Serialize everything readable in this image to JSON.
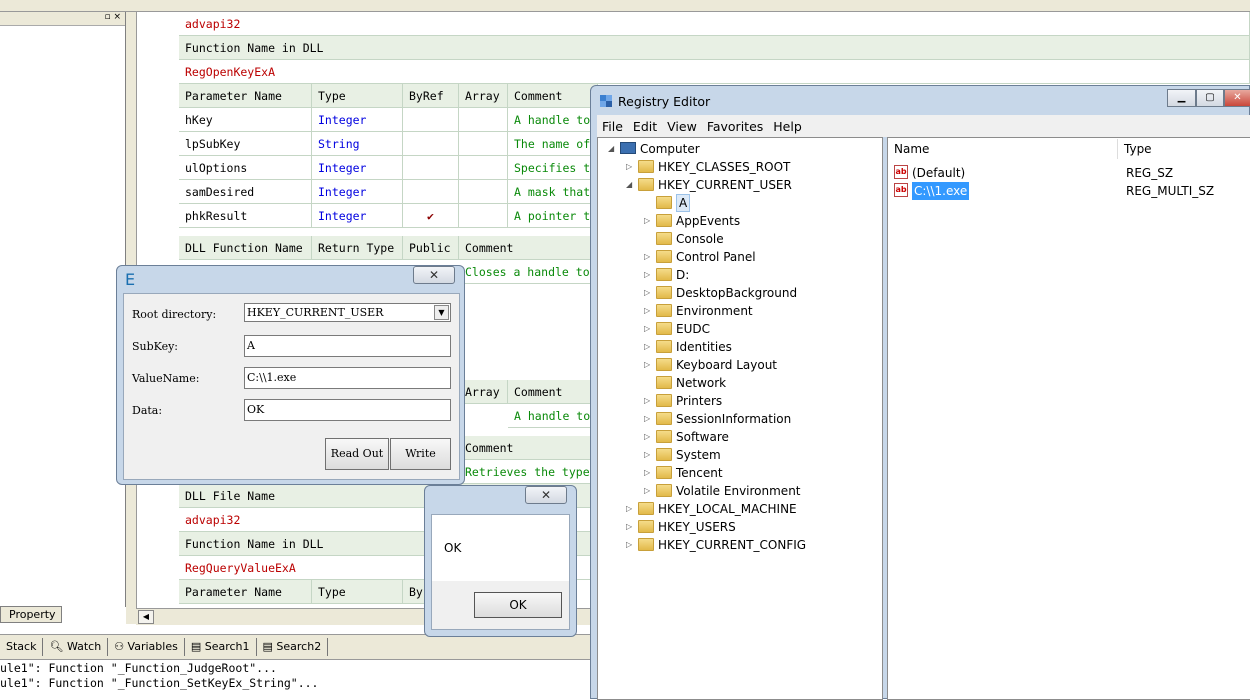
{
  "ide": {
    "left_pane_btns": "▫ ×",
    "property_tab": "Property",
    "bottom_tabs": [
      "Stack",
      "Watch",
      "Variables",
      "Search1",
      "Search2"
    ],
    "output_lines": [
      "ule1\": Function \"_Function_JudgeRoot\"...",
      "ule1\": Function \"_Function_SetKeyEx_String\"..."
    ],
    "code": {
      "dll1": "advapi32",
      "fn_in_dll_label": "Function Name in DLL",
      "fn1": "RegOpenKeyExA",
      "param_headers": [
        "Parameter Name",
        "Type",
        "ByRef",
        "Array",
        "Comment"
      ],
      "params": [
        {
          "name": "hKey",
          "type": "Integer",
          "byref": "",
          "comment": "A handle to"
        },
        {
          "name": "lpSubKey",
          "type": "String",
          "byref": "",
          "comment": "The name of"
        },
        {
          "name": "ulOptions",
          "type": "Integer",
          "byref": "",
          "comment": "Specifies t"
        },
        {
          "name": "samDesired",
          "type": "Integer",
          "byref": "",
          "comment": "A mask that"
        },
        {
          "name": "phkResult",
          "type": "Integer",
          "byref": "✔",
          "comment": "A pointer t"
        }
      ],
      "dll_fn_headers": [
        "DLL Function Name",
        "Return Type",
        "Public",
        "Comment"
      ],
      "row_closes": "Closes a handle to",
      "array_label": "Array",
      "comment_label": "Comment",
      "row_a_handle": "A handle to",
      "comment_label2": "Comment",
      "row_retrieves": "Retrieves the type",
      "dll_file_label": "DLL File Name",
      "dll2": "advapi32",
      "fn_in_dll_label2": "Function Name in DLL",
      "fn2": "RegQueryValueExA",
      "param_name_label": "Parameter Name",
      "type_label": "Type",
      "byref_partial": "By"
    }
  },
  "e_dialog": {
    "title": "E",
    "close": "✕",
    "root_label": "Root directory:",
    "root_value": "HKEY_CURRENT_USER",
    "subkey_label": "SubKey:",
    "subkey_value": "A",
    "valuename_label": "ValueName:",
    "valuename_value": "C:\\\\1.exe",
    "data_label": "Data:",
    "data_value": "OK",
    "readout_btn": "Read Out",
    "write_btn": "Write"
  },
  "ok_dialog": {
    "close": "✕",
    "message": "OK",
    "ok_btn": "OK"
  },
  "registry": {
    "title": "Registry Editor",
    "menu": [
      "File",
      "Edit",
      "View",
      "Favorites",
      "Help"
    ],
    "tree": {
      "computer": "Computer",
      "roots": [
        "HKEY_CLASSES_ROOT",
        "HKEY_CURRENT_USER",
        "HKEY_LOCAL_MACHINE",
        "HKEY_USERS",
        "HKEY_CURRENT_CONFIG"
      ],
      "hkcu_children": [
        "A",
        "AppEvents",
        "Console",
        "Control Panel",
        "D:",
        "DesktopBackground",
        "Environment",
        "EUDC",
        "Identities",
        "Keyboard Layout",
        "Network",
        "Printers",
        "SessionInformation",
        "Software",
        "System",
        "Tencent",
        "Volatile Environment"
      ]
    },
    "columns": [
      "Name",
      "Type"
    ],
    "values": [
      {
        "name": "(Default)",
        "type": "REG_SZ"
      },
      {
        "name": "C:\\\\1.exe",
        "type": "REG_MULTI_SZ"
      }
    ]
  }
}
